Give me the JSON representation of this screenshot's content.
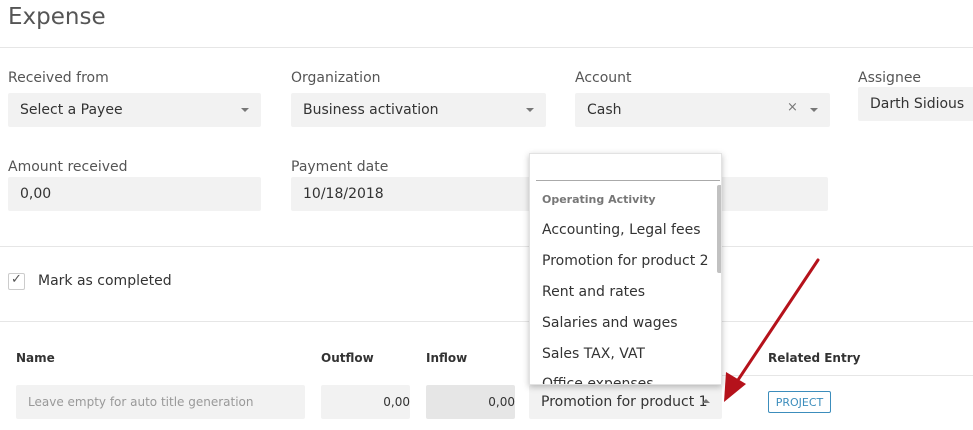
{
  "page": {
    "title": "Expense"
  },
  "form": {
    "received_from": {
      "label": "Received from",
      "value": "Select a Payee"
    },
    "organization": {
      "label": "Organization",
      "value": "Business activation"
    },
    "account": {
      "label": "Account",
      "value": "Cash",
      "clear_glyph": "×"
    },
    "assignee": {
      "label": "Assignee",
      "value": "Darth Sidious"
    },
    "amount_received": {
      "label": "Amount received",
      "value": "0,00"
    },
    "payment_date": {
      "label": "Payment date",
      "value": "10/18/2018"
    },
    "mark_completed": {
      "label": "Mark as completed",
      "checked": true,
      "check_glyph": "✓"
    }
  },
  "table": {
    "headers": {
      "name": "Name",
      "outflow": "Outflow",
      "inflow": "Inflow",
      "related": "Related Entry"
    },
    "row": {
      "name_placeholder": "Leave empty for auto title generation",
      "outflow": "0,00",
      "inflow": "0,00",
      "category": "Promotion for product 1",
      "related_button": "PROJECT"
    }
  },
  "dropdown": {
    "search_value": "",
    "group": "Operating Activity",
    "items": [
      "Accounting, Legal fees",
      "Promotion for product 2",
      "Rent and rates",
      "Salaries and wages",
      "Sales TAX, VAT",
      "Office expenses"
    ]
  },
  "annotation": {
    "arrow_color": "#b5121b"
  }
}
